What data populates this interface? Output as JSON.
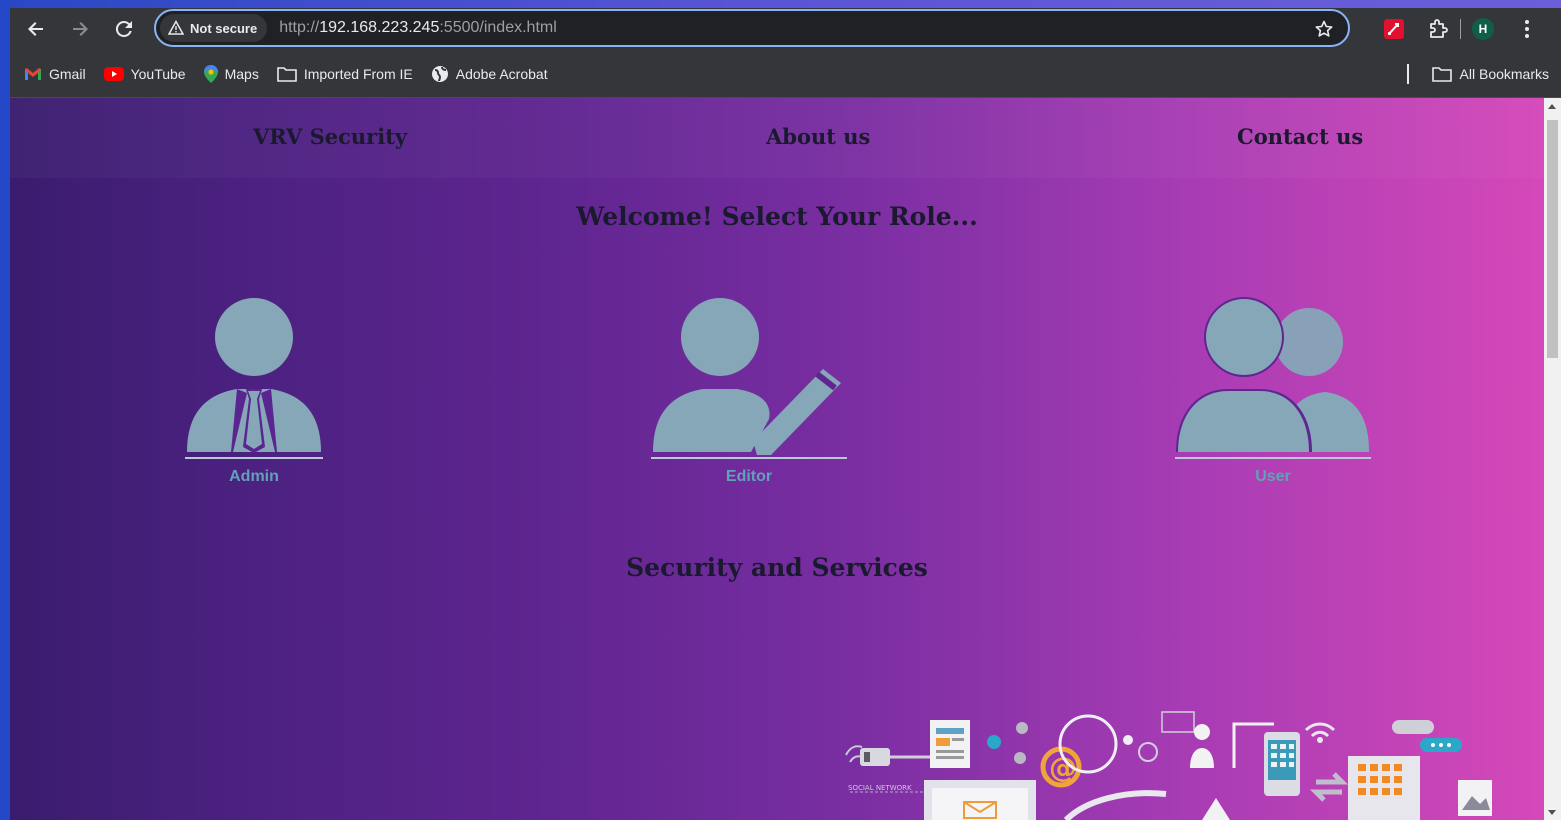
{
  "browser": {
    "security_chip": "Not secure",
    "url_prefix": "http://",
    "url_host": "192.168.223.245",
    "url_suffix": ":5500/index.html",
    "profile_initial": "H",
    "icons": [
      "back-icon",
      "forward-icon",
      "reload-icon",
      "warning-icon",
      "star-icon",
      "extension-icon",
      "puzzle-icon",
      "more-icon"
    ]
  },
  "bookmarks": {
    "items": [
      {
        "label": "Gmail",
        "icon": "gmail-icon"
      },
      {
        "label": "YouTube",
        "icon": "youtube-icon"
      },
      {
        "label": "Maps",
        "icon": "maps-icon"
      },
      {
        "label": "Imported From IE",
        "icon": "folder-icon"
      },
      {
        "label": "Adobe Acrobat",
        "icon": "globe-icon"
      }
    ],
    "all_bookmarks": "All Bookmarks"
  },
  "page": {
    "nav": {
      "brand": "VRV Security",
      "about": "About us",
      "contact": "Contact us"
    },
    "welcome_heading": "Welcome! Select Your Role...",
    "roles": [
      {
        "label": "Admin",
        "icon": "admin-icon"
      },
      {
        "label": "Editor",
        "icon": "editor-icon"
      },
      {
        "label": "User",
        "icon": "users-icon"
      }
    ],
    "section_heading": "Security and Services",
    "illustration": {
      "caption": "SOCIAL NETWORK"
    },
    "colors": {
      "gradient_start": "#3a1c6e",
      "gradient_end": "#d548b9",
      "role_icon": "#86a7b8",
      "role_label": "#5fa3b6"
    }
  }
}
